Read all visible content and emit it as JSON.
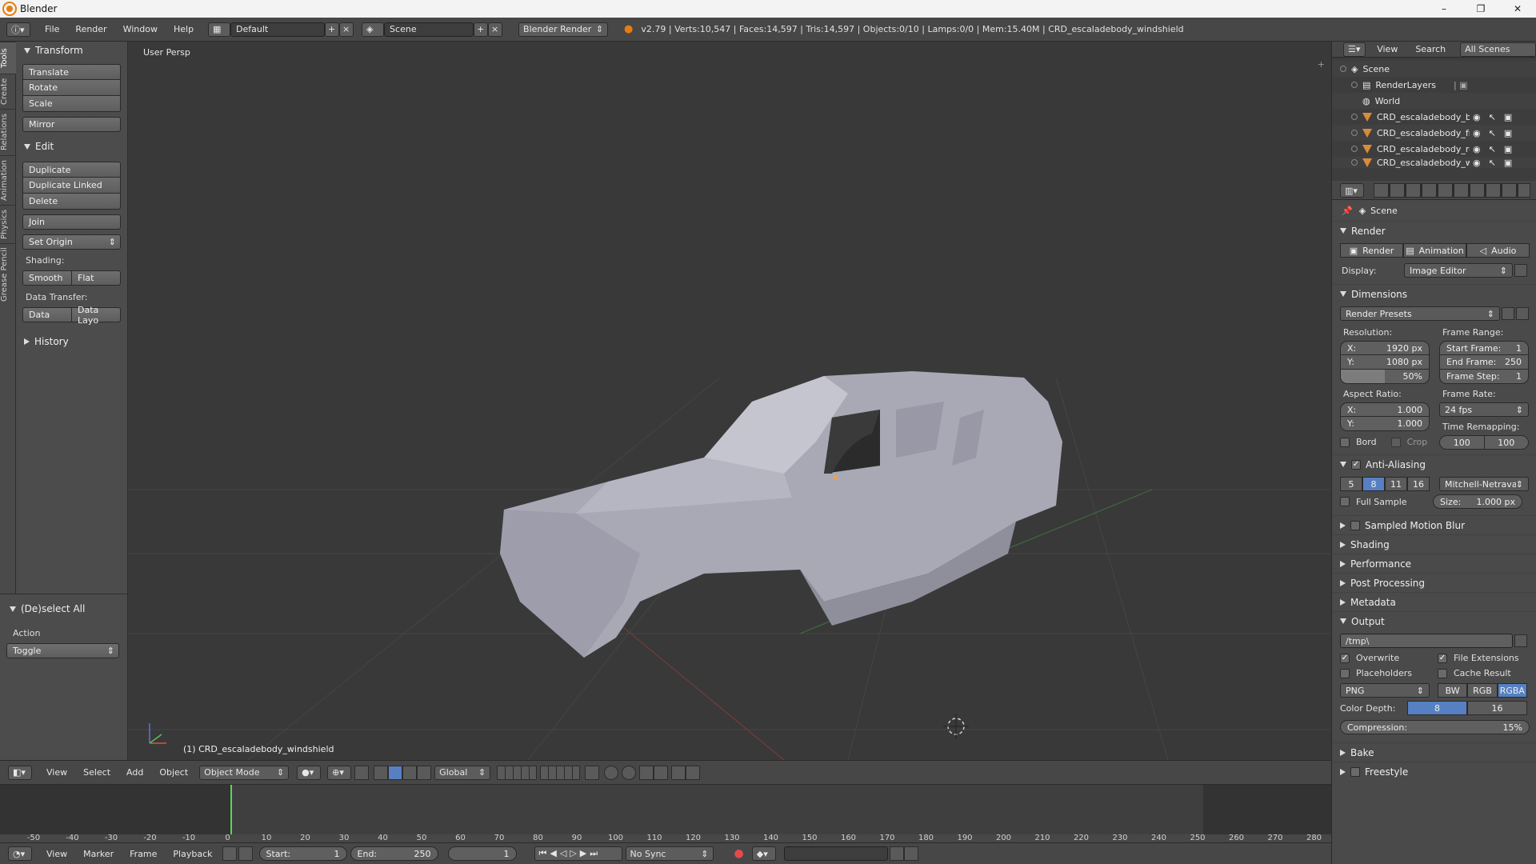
{
  "app": {
    "title": "Blender"
  },
  "window_controls": [
    "–",
    "❐",
    "✕"
  ],
  "info_header": {
    "menus": [
      "File",
      "Render",
      "Window",
      "Help"
    ],
    "layout": "Default",
    "scene": "Scene",
    "engine": "Blender Render",
    "stats": "v2.79 | Verts:10,547 | Faces:14,597 | Tris:14,597 | Objects:0/10 | Lamps:0/0 | Mem:15.40M | CRD_escaladebody_windshield"
  },
  "tool_tabs": [
    "Tools",
    "Create",
    "Relations",
    "Animation",
    "Physics",
    "Grease Pencil"
  ],
  "toolshelf": {
    "transform_title": "Transform",
    "transform_buttons": [
      "Translate",
      "Rotate",
      "Scale"
    ],
    "mirror": "Mirror",
    "edit_title": "Edit",
    "edit_buttons": [
      "Duplicate",
      "Duplicate Linked",
      "Delete"
    ],
    "join": "Join",
    "set_origin": "Set Origin",
    "shading_label": "Shading:",
    "smooth": "Smooth",
    "flat": "Flat",
    "data_transfer_label": "Data Transfer:",
    "data": "Data",
    "data_layo": "Data Layo",
    "history": "History"
  },
  "operator_panel": {
    "title": "(De)select All",
    "action_label": "Action",
    "action_value": "Toggle"
  },
  "viewport": {
    "view_label": "User Persp",
    "object_label": "(1) CRD_escaladebody_windshield"
  },
  "view3d_header": {
    "menus": [
      "View",
      "Select",
      "Add",
      "Object"
    ],
    "mode": "Object Mode",
    "orientation": "Global"
  },
  "timeline": {
    "ticks": [
      "-50",
      "-40",
      "-30",
      "-20",
      "-10",
      "0",
      "10",
      "20",
      "30",
      "40",
      "50",
      "60",
      "70",
      "80",
      "90",
      "100",
      "110",
      "120",
      "130",
      "140",
      "150",
      "160",
      "170",
      "180",
      "190",
      "200",
      "210",
      "220",
      "230",
      "240",
      "250",
      "260",
      "270",
      "280"
    ],
    "current_frame": 1,
    "menus": [
      "View",
      "Marker",
      "Frame",
      "Playback"
    ],
    "start_label": "Start:",
    "start_value": "1",
    "end_label": "End:",
    "end_value": "250",
    "frame_value": "1",
    "sync": "No Sync"
  },
  "outliner": {
    "menus": [
      "View",
      "Search"
    ],
    "filter": "All Scenes",
    "rows": [
      "Scene",
      "RenderLayers",
      "World",
      "CRD_escaladebody_bol",
      "CRD_escaladebody_fro",
      "CRD_escaladebody_roc",
      "CRD_escaladebody_wi"
    ]
  },
  "properties": {
    "context": "Scene",
    "render_title": "Render",
    "render_btn": "Render",
    "animation_btn": "Animation",
    "audio_btn": "Audio",
    "display_label": "Display:",
    "display_value": "Image Editor",
    "dimensions_title": "Dimensions",
    "render_presets": "Render Presets",
    "resolution_label": "Resolution:",
    "res_x": "X:",
    "res_x_val": "1920 px",
    "res_y": "Y:",
    "res_y_val": "1080 px",
    "res_pct": "50%",
    "frame_range_label": "Frame Range:",
    "start_frame": "Start Frame:",
    "start_frame_val": "1",
    "end_frame": "End Frame:",
    "end_frame_val": "250",
    "frame_step": "Frame Step:",
    "frame_step_val": "1",
    "aspect_label": "Aspect Ratio:",
    "asp_x": "X:",
    "asp_x_val": "1.000",
    "asp_y": "Y:",
    "asp_y_val": "1.000",
    "frame_rate_label": "Frame Rate:",
    "frame_rate_val": "24 fps",
    "time_remap_label": "Time Remapping:",
    "remap_old": "100",
    "remap_new": "100",
    "bord": "Bord",
    "crop": "Crop",
    "aa_title": "Anti-Aliasing",
    "aa_samples": [
      "5",
      "8",
      "11",
      "16"
    ],
    "aa_filter": "Mitchell-Netravali",
    "full_sample": "Full Sample",
    "size_label": "Size:",
    "size_val": "1.000 px",
    "collapsed_sections": [
      "Sampled Motion Blur",
      "Shading",
      "Performance",
      "Post Processing",
      "Metadata"
    ],
    "output_title": "Output",
    "output_path": "/tmp\\",
    "overwrite": "Overwrite",
    "file_ext": "File Extensions",
    "placeholders": "Placeholders",
    "cache_result": "Cache Result",
    "format": "PNG",
    "color_modes": [
      "BW",
      "RGB",
      "RGBA"
    ],
    "color_depth_label": "Color Depth:",
    "depth_8": "8",
    "depth_16": "16",
    "compression_label": "Compression:",
    "compression_val": "15%",
    "bake_title": "Bake",
    "freestyle_title": "Freestyle"
  }
}
